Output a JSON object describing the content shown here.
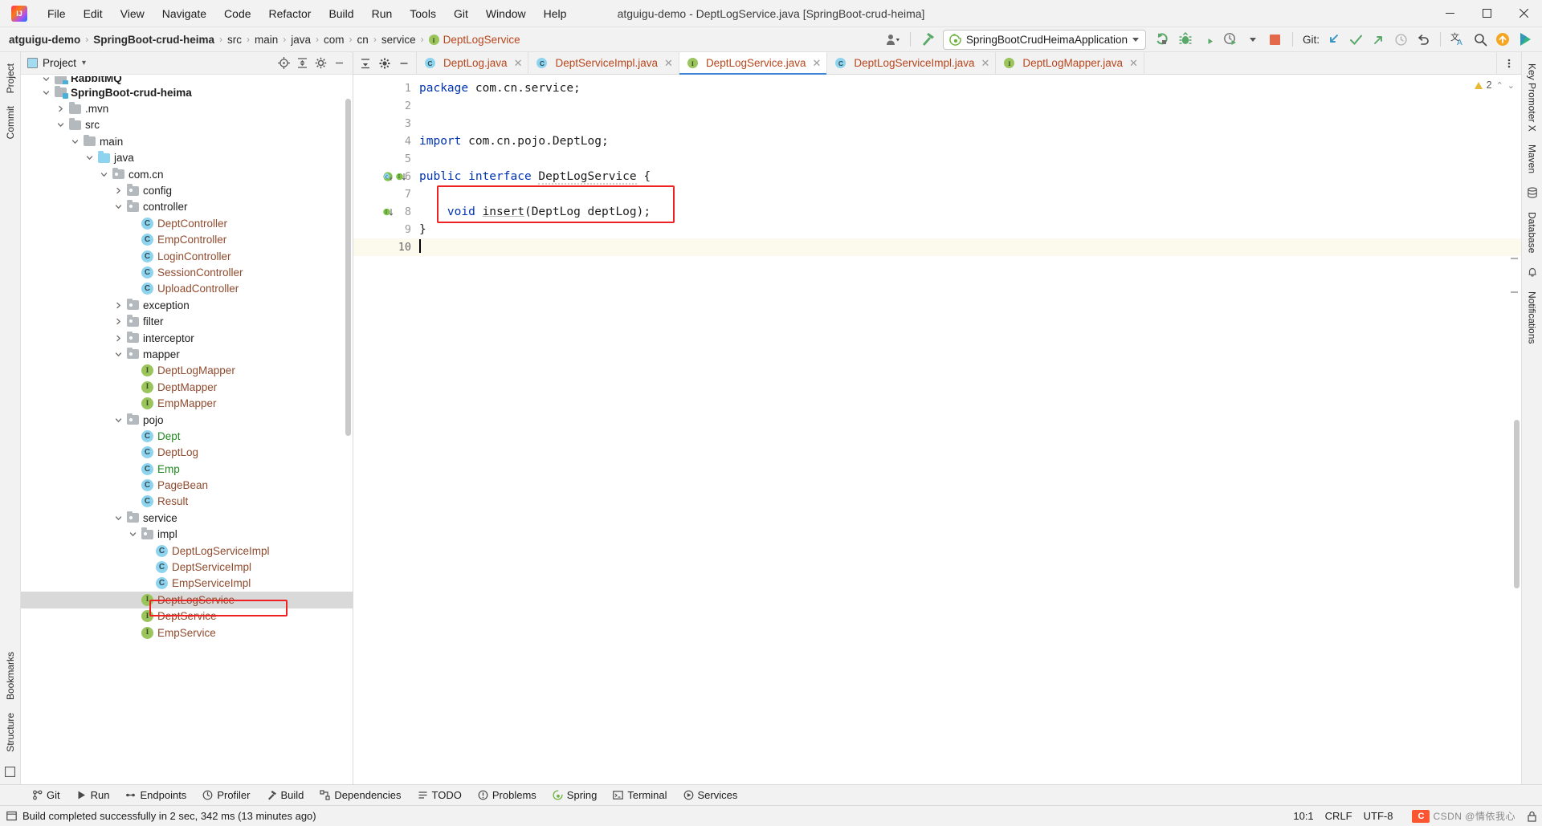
{
  "window": {
    "title": "atguigu-demo - DeptLogService.java [SpringBoot-crud-heima]",
    "logo_icon": "intellij-idea-logo",
    "minimize_label": "—",
    "maximize_label": "❐",
    "close_label": "✕"
  },
  "menubar": {
    "items": [
      {
        "label": "File"
      },
      {
        "label": "Edit"
      },
      {
        "label": "View"
      },
      {
        "label": "Navigate"
      },
      {
        "label": "Code"
      },
      {
        "label": "Refactor"
      },
      {
        "label": "Build"
      },
      {
        "label": "Run"
      },
      {
        "label": "Tools"
      },
      {
        "label": "Git"
      },
      {
        "label": "Window"
      },
      {
        "label": "Help"
      }
    ]
  },
  "navbar": {
    "breadcrumbs": [
      {
        "label": "atguigu-demo",
        "style": "bold"
      },
      {
        "label": "SpringBoot-crud-heima",
        "style": "bold"
      },
      {
        "label": "src",
        "style": "plain"
      },
      {
        "label": "main",
        "style": "plain"
      },
      {
        "label": "java",
        "style": "plain"
      },
      {
        "label": "com",
        "style": "plain"
      },
      {
        "label": "cn",
        "style": "plain"
      },
      {
        "label": "service",
        "style": "plain"
      },
      {
        "label": "DeptLogService",
        "style": "file",
        "icon": "interface-icon"
      }
    ],
    "separator": "›",
    "run_config": {
      "label": "SpringBootCrudHeimaApplication",
      "icon": "spring-boot-icon"
    },
    "actions": [
      {
        "name": "user-settings-icon",
        "label": ""
      },
      {
        "name": "hammer-build-icon",
        "label": ""
      },
      {
        "name": "run-icon",
        "label": ""
      },
      {
        "name": "debug-icon",
        "label": ""
      },
      {
        "name": "run-with-coverage-icon",
        "label": ""
      },
      {
        "name": "profiler-icon",
        "label": ""
      },
      {
        "name": "stop-icon",
        "label": ""
      }
    ],
    "git_label": "Git:",
    "git_actions": [
      {
        "name": "git-update-icon"
      },
      {
        "name": "git-commit-checkmark-icon"
      },
      {
        "name": "git-push-icon"
      },
      {
        "name": "git-history-icon"
      },
      {
        "name": "git-rollback-icon"
      }
    ],
    "right_actions": [
      {
        "name": "translate-icon"
      },
      {
        "name": "search-everywhere-icon"
      },
      {
        "name": "update-available-icon"
      },
      {
        "name": "ai-assistant-icon"
      }
    ]
  },
  "left_strip": {
    "tabs": [
      {
        "label": "Project",
        "name": "tool-window-project"
      },
      {
        "label": "Commit",
        "name": "tool-window-commit"
      },
      {
        "label": "Bookmarks",
        "name": "tool-window-bookmarks"
      },
      {
        "label": "Structure",
        "name": "tool-window-structure"
      }
    ]
  },
  "right_strip": {
    "tabs": [
      {
        "label": "Key Promoter X",
        "name": "tool-window-key-promoter-x"
      },
      {
        "label": "Maven",
        "name": "tool-window-maven"
      },
      {
        "label": "Database",
        "name": "tool-window-database"
      },
      {
        "label": "Notifications",
        "name": "tool-window-notifications"
      }
    ]
  },
  "project_panel": {
    "title": "Project",
    "dropdown_caret": "▾",
    "actions": [
      {
        "name": "select-opened-file-icon"
      },
      {
        "name": "expand-all-icon"
      },
      {
        "name": "collapse-all-icon"
      },
      {
        "name": "settings-gear-icon"
      },
      {
        "name": "hide-panel-icon"
      }
    ],
    "tree": [
      {
        "label": "RabbitMQ",
        "depth": 1,
        "twig": "expanded",
        "icon": "module-folder",
        "color": "dark",
        "bold": true,
        "clipped": true
      },
      {
        "label": "SpringBoot-crud-heima",
        "depth": 1,
        "twig": "expanded",
        "icon": "module-folder",
        "color": "dark",
        "bold": true
      },
      {
        "label": ".mvn",
        "depth": 2,
        "twig": "collapsed",
        "icon": "folder-plain",
        "color": "dark"
      },
      {
        "label": "src",
        "depth": 2,
        "twig": "expanded",
        "icon": "folder-plain",
        "color": "dark"
      },
      {
        "label": "main",
        "depth": 3,
        "twig": "expanded",
        "icon": "folder-plain",
        "color": "dark"
      },
      {
        "label": "java",
        "depth": 4,
        "twig": "expanded",
        "icon": "folder-source",
        "color": "dark"
      },
      {
        "label": "com.cn",
        "depth": 5,
        "twig": "expanded",
        "icon": "folder-package",
        "color": "dark"
      },
      {
        "label": "config",
        "depth": 6,
        "twig": "collapsed",
        "icon": "folder-package",
        "color": "dark"
      },
      {
        "label": "controller",
        "depth": 6,
        "twig": "expanded",
        "icon": "folder-package",
        "color": "dark"
      },
      {
        "label": "DeptController",
        "depth": 7,
        "twig": "none",
        "icon": "class-icon",
        "color": "brown"
      },
      {
        "label": "EmpController",
        "depth": 7,
        "twig": "none",
        "icon": "class-icon",
        "color": "brown"
      },
      {
        "label": "LoginController",
        "depth": 7,
        "twig": "none",
        "icon": "class-icon",
        "color": "brown"
      },
      {
        "label": "SessionController",
        "depth": 7,
        "twig": "none",
        "icon": "class-icon",
        "color": "brown"
      },
      {
        "label": "UploadController",
        "depth": 7,
        "twig": "none",
        "icon": "class-icon",
        "color": "brown"
      },
      {
        "label": "exception",
        "depth": 6,
        "twig": "collapsed",
        "icon": "folder-package",
        "color": "dark"
      },
      {
        "label": "filter",
        "depth": 6,
        "twig": "collapsed",
        "icon": "folder-package",
        "color": "dark"
      },
      {
        "label": "interceptor",
        "depth": 6,
        "twig": "collapsed",
        "icon": "folder-package",
        "color": "dark"
      },
      {
        "label": "mapper",
        "depth": 6,
        "twig": "expanded",
        "icon": "folder-package",
        "color": "dark"
      },
      {
        "label": "DeptLogMapper",
        "depth": 7,
        "twig": "none",
        "icon": "interface-icon",
        "color": "brown"
      },
      {
        "label": "DeptMapper",
        "depth": 7,
        "twig": "none",
        "icon": "interface-icon",
        "color": "brown"
      },
      {
        "label": "EmpMapper",
        "depth": 7,
        "twig": "none",
        "icon": "interface-icon",
        "color": "brown"
      },
      {
        "label": "pojo",
        "depth": 6,
        "twig": "expanded",
        "icon": "folder-package",
        "color": "dark"
      },
      {
        "label": "Dept",
        "depth": 7,
        "twig": "none",
        "icon": "class-icon",
        "color": "green"
      },
      {
        "label": "DeptLog",
        "depth": 7,
        "twig": "none",
        "icon": "class-icon",
        "color": "brown"
      },
      {
        "label": "Emp",
        "depth": 7,
        "twig": "none",
        "icon": "class-icon",
        "color": "green"
      },
      {
        "label": "PageBean",
        "depth": 7,
        "twig": "none",
        "icon": "class-icon",
        "color": "brown"
      },
      {
        "label": "Result",
        "depth": 7,
        "twig": "none",
        "icon": "class-icon",
        "color": "brown"
      },
      {
        "label": "service",
        "depth": 6,
        "twig": "expanded",
        "icon": "folder-package",
        "color": "dark"
      },
      {
        "label": "impl",
        "depth": 7,
        "twig": "expanded",
        "icon": "folder-package",
        "color": "dark"
      },
      {
        "label": "DeptLogServiceImpl",
        "depth": 8,
        "twig": "none",
        "icon": "class-icon",
        "color": "brown"
      },
      {
        "label": "DeptServiceImpl",
        "depth": 8,
        "twig": "none",
        "icon": "class-icon",
        "color": "brown"
      },
      {
        "label": "EmpServiceImpl",
        "depth": 8,
        "twig": "none",
        "icon": "class-icon",
        "color": "brown"
      },
      {
        "label": "DeptLogService",
        "depth": 7,
        "twig": "none",
        "icon": "interface-icon",
        "color": "brown",
        "selected": true,
        "highlighted": true
      },
      {
        "label": "DeptService",
        "depth": 7,
        "twig": "none",
        "icon": "interface-icon",
        "color": "brown"
      },
      {
        "label": "EmpService",
        "depth": 7,
        "twig": "none",
        "icon": "interface-icon",
        "color": "brown"
      }
    ]
  },
  "editor": {
    "tabs": [
      {
        "label": "DeptLog.java",
        "icon": "class-icon",
        "active": false
      },
      {
        "label": "DeptServiceImpl.java",
        "icon": "class-icon",
        "active": false
      },
      {
        "label": "DeptLogService.java",
        "icon": "interface-icon",
        "active": true
      },
      {
        "label": "DeptLogServiceImpl.java",
        "icon": "class-icon",
        "active": false
      },
      {
        "label": "DeptLogMapper.java",
        "icon": "interface-icon",
        "active": false
      }
    ],
    "tab_close_glyph": "✕",
    "inspection_widget": {
      "count": "2",
      "icon": "warning-triangle-icon",
      "caret_up": "⌃",
      "caret_down": "⌄"
    },
    "lines": [
      {
        "no": "1",
        "tokens": [
          {
            "t": "package",
            "c": "kw"
          },
          {
            "t": " com.cn.service;",
            "c": ""
          }
        ],
        "gutter": []
      },
      {
        "no": "2",
        "tokens": [],
        "gutter": []
      },
      {
        "no": "3",
        "tokens": [],
        "gutter": []
      },
      {
        "no": "4",
        "tokens": [
          {
            "t": "import",
            "c": "kw"
          },
          {
            "t": " com.cn.pojo.DeptLog;",
            "c": ""
          }
        ],
        "gutter": []
      },
      {
        "no": "5",
        "tokens": [],
        "gutter": []
      },
      {
        "no": "6",
        "tokens": [
          {
            "t": "public interface",
            "c": "kw"
          },
          {
            "t": " ",
            "c": ""
          },
          {
            "t": "DeptLogService",
            "c": "wavy"
          },
          {
            "t": " {",
            "c": ""
          }
        ],
        "gutter": [
          "spring-bean-icon",
          "implemented-by-icon"
        ]
      },
      {
        "no": "7",
        "tokens": [],
        "gutter": []
      },
      {
        "no": "8",
        "tokens": [
          {
            "t": "    void ",
            "c": "kw"
          },
          {
            "t": "insert",
            "c": "ident-u"
          },
          {
            "t": "(DeptLog deptLog);",
            "c": ""
          }
        ],
        "gutter": [
          "implemented-by-icon"
        ]
      },
      {
        "no": "9",
        "tokens": [
          {
            "t": "}",
            "c": ""
          }
        ],
        "gutter": []
      },
      {
        "no": "10",
        "tokens": [],
        "gutter": [],
        "current": true
      }
    ],
    "highlight_box": {
      "line_from": 8,
      "line_to": 8,
      "color": "#ee2222"
    }
  },
  "bottom_toolwindows": [
    {
      "label": "Git",
      "icon": "git-branch-icon"
    },
    {
      "label": "Run",
      "icon": "run-icon"
    },
    {
      "label": "Endpoints",
      "icon": "endpoints-icon"
    },
    {
      "label": "Profiler",
      "icon": "profiler-icon"
    },
    {
      "label": "Build",
      "icon": "build-hammer-icon"
    },
    {
      "label": "Dependencies",
      "icon": "dependencies-icon"
    },
    {
      "label": "TODO",
      "icon": "todo-icon"
    },
    {
      "label": "Problems",
      "icon": "problems-icon"
    },
    {
      "label": "Spring",
      "icon": "spring-leaf-icon"
    },
    {
      "label": "Terminal",
      "icon": "terminal-icon"
    },
    {
      "label": "Services",
      "icon": "services-icon"
    }
  ],
  "statusbar": {
    "message": "Build completed successfully in 2 sec, 342 ms (13 minutes ago)",
    "message_icon": "build-status-icon",
    "caret_position": "10:1",
    "line_separator": "CRLF",
    "encoding": "UTF-8",
    "indent": "",
    "watermark": "CSDN @情依我心",
    "lock_icon": "read-only-lock-icon"
  },
  "colors": {
    "accent_blue": "#3d86d4",
    "tab_active_bg": "#ffffff",
    "panel_bg": "#f2f2f2",
    "keyword": "#0033b3",
    "file_brown": "#8f4b2e",
    "file_green": "#238a22",
    "highlight_red": "#ee2222",
    "sidebar_select": "#d9d9d9",
    "current_line": "#fcfaed"
  }
}
